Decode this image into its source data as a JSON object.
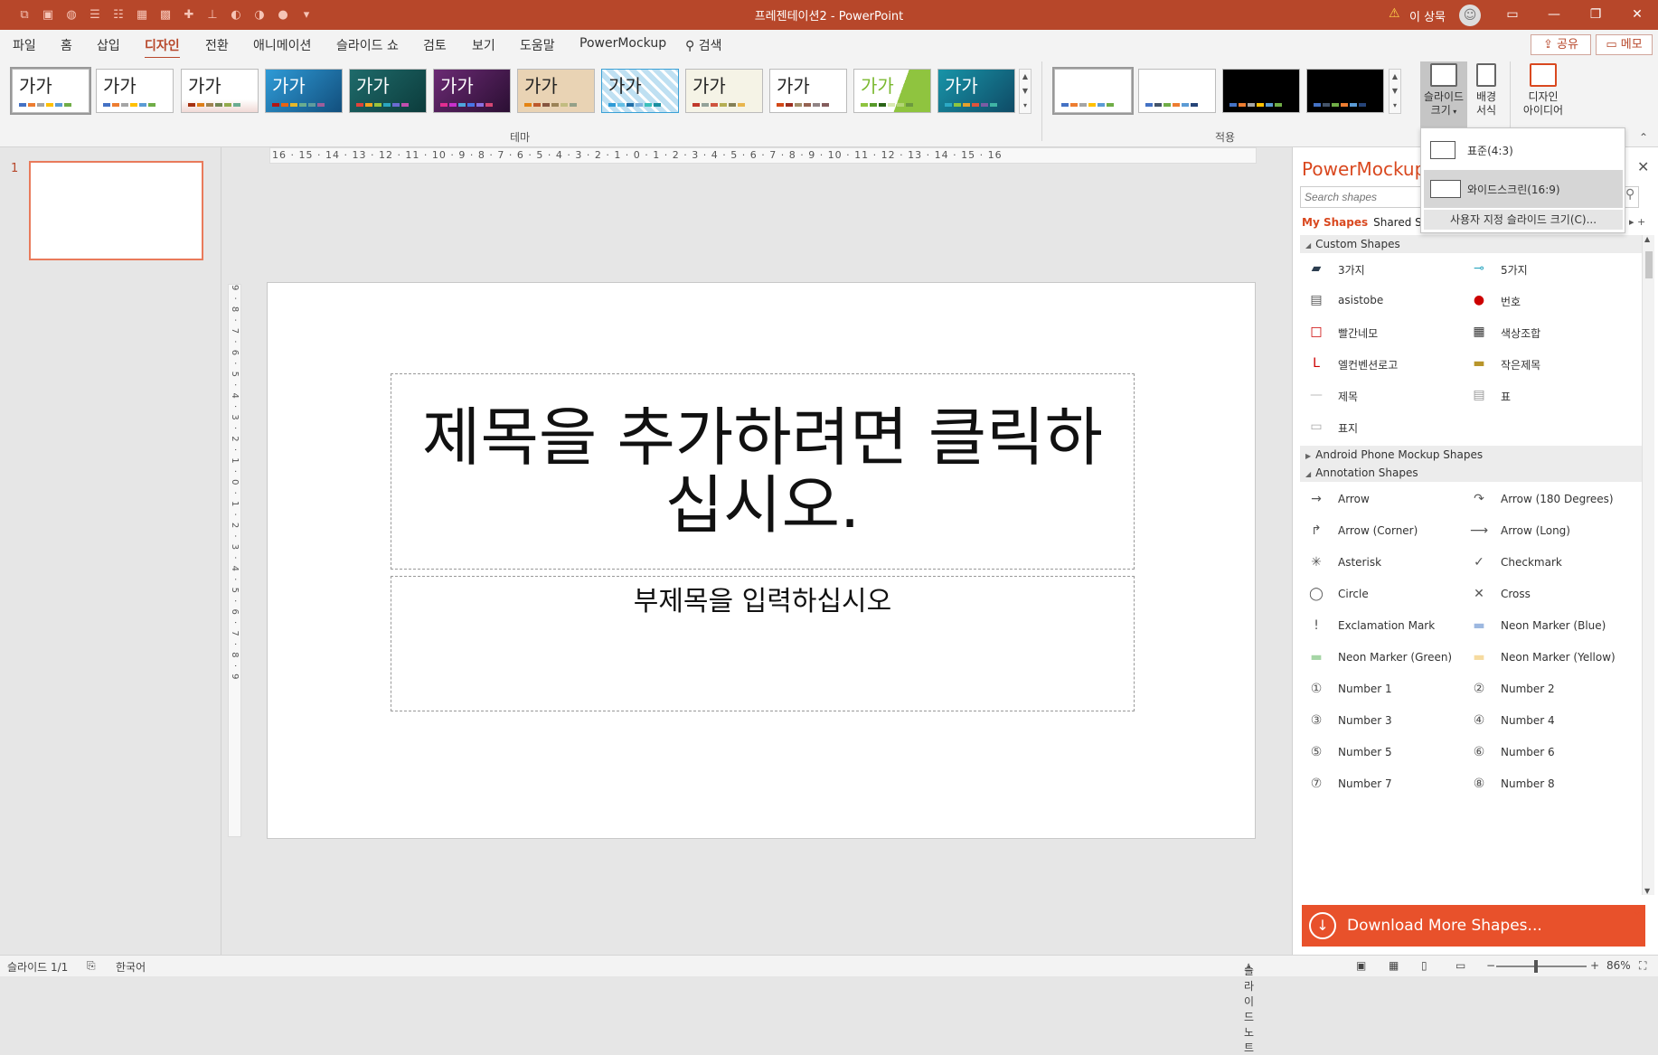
{
  "app": {
    "doc_title": "프레젠테이션2  -  PowerPoint",
    "user_name": "이 상묵",
    "accent": "#b7472a",
    "window_controls": [
      "restore-ribbon",
      "minimize",
      "maximize",
      "close"
    ]
  },
  "menu": {
    "tabs": [
      "파일",
      "홈",
      "삽입",
      "디자인",
      "전환",
      "애니메이션",
      "슬라이드 쇼",
      "검토",
      "보기",
      "도움말",
      "PowerMockup"
    ],
    "active_tab": "디자인",
    "search_label": "검색",
    "share_label": "공유",
    "memo_label": "메모"
  },
  "ribbon": {
    "theme_label": "가가",
    "theme_group": "테마",
    "variant_group": "적용",
    "slide_size": "슬라이드\n크기",
    "format_bg": "배경\n서식",
    "design_ideas": "디자인\n아이디어"
  },
  "slide_size_menu": {
    "standard": "표준(4:3)",
    "widescreen": "와이드스크린(16:9)",
    "custom": "사용자 지정 슬라이드 크기(C)..."
  },
  "thumbnails": {
    "slide_number": "1"
  },
  "rulers": {
    "horizontal": "16 · 15 · 14 · 13 · 12 · 11 · 10 · 9 · 8 · 7 · 6 · 5 · 4 · 3 · 2 · 1 · 0 · 1 · 2 · 3 · 4 · 5 · 6 · 7 · 8 · 9 · 10 · 11 · 12 · 13 · 14 · 15 · 16",
    "vertical": "9 · 8 · 7 · 6 · 5 · 4 · 3 · 2 · 1 · 0 · 1 · 2 · 3 · 4 · 5 · 6 · 7 · 8 · 9"
  },
  "slide": {
    "title_placeholder": "제목을 추가하려면 클릭하십시오.",
    "subtitle_placeholder": "부제목을 입력하십시오"
  },
  "powermockup": {
    "title": "PowerMockup",
    "search_placeholder": "Search shapes",
    "tab_my": "My Shapes",
    "tab_shared": "Shared Shapes",
    "section_custom": "Custom Shapes",
    "custom_shapes": [
      "3가지",
      "5가지",
      "asistobe",
      "번호",
      "빨간네모",
      "색상조합",
      "엘컨벤션로고",
      "작은제목",
      "제목",
      "표",
      "표지"
    ],
    "section_android": "Android Phone Mockup Shapes",
    "section_annotation": "Annotation Shapes",
    "annotation_shapes": [
      "Arrow",
      "Arrow (180 Degrees)",
      "Arrow (Corner)",
      "Arrow (Long)",
      "Asterisk",
      "Checkmark",
      "Circle",
      "Cross",
      "Exclamation Mark",
      "Neon Marker (Blue)",
      "Neon Marker (Green)",
      "Neon Marker (Yellow)",
      "Number 1",
      "Number 2",
      "Number 3",
      "Number 4",
      "Number 5",
      "Number 6",
      "Number 7",
      "Number 8"
    ],
    "download_label": "Download More Shapes..."
  },
  "status": {
    "slide_count": "슬라이드 1/1",
    "language": "한국어",
    "notes": "슬라이드 노트",
    "zoom": "86%"
  }
}
